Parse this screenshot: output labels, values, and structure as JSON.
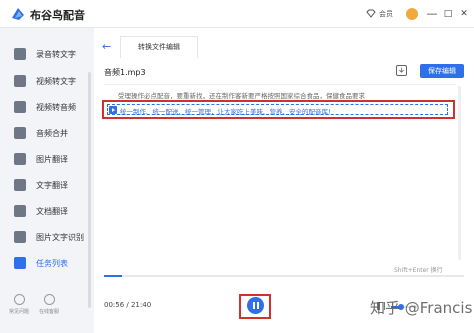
{
  "app": {
    "title": "布谷鸟配音",
    "member_label": "会员",
    "window_controls": [
      "—",
      "□",
      "✕"
    ]
  },
  "sidebar": {
    "items": [
      {
        "label": "录音转文字",
        "icon": "mic-icon",
        "active": false
      },
      {
        "label": "视频转文字",
        "icon": "video-icon",
        "active": false
      },
      {
        "label": "视频转音频",
        "icon": "video-audio-icon",
        "active": false
      },
      {
        "label": "音频合并",
        "icon": "merge-icon",
        "active": false
      },
      {
        "label": "图片翻译",
        "icon": "image-translate-icon",
        "active": false
      },
      {
        "label": "文字翻译",
        "icon": "text-translate-icon",
        "active": false
      },
      {
        "label": "文档翻译",
        "icon": "doc-translate-icon",
        "active": false
      },
      {
        "label": "图片文字识别",
        "icon": "ocr-icon",
        "active": false
      },
      {
        "label": "任务列表",
        "icon": "task-list-icon",
        "active": true
      }
    ],
    "bottom_tools": [
      {
        "label": "常见问题",
        "icon": "help-icon"
      },
      {
        "label": "在线客服",
        "icon": "service-icon"
      }
    ]
  },
  "main": {
    "tab_label": "转换文件编辑",
    "file_name": "音频1.mp3",
    "save_label": "保存编辑",
    "previous_text": "受理操作必点配音，要重新找，还在制作客新要严格按照国家综合食品，保健食品要求",
    "current_text": "统一制作、统一配送、统一管理，让大家吃上美味、营养、安全的配音库！",
    "hint": "Shift+Enter 换行",
    "time": "00:56 / 21:40",
    "progress": 0.05,
    "volume": 0.4,
    "watermark": "知乎 @Francis"
  },
  "colors": {
    "accent": "#2f6fea",
    "highlight_border": "#d32f2f"
  }
}
